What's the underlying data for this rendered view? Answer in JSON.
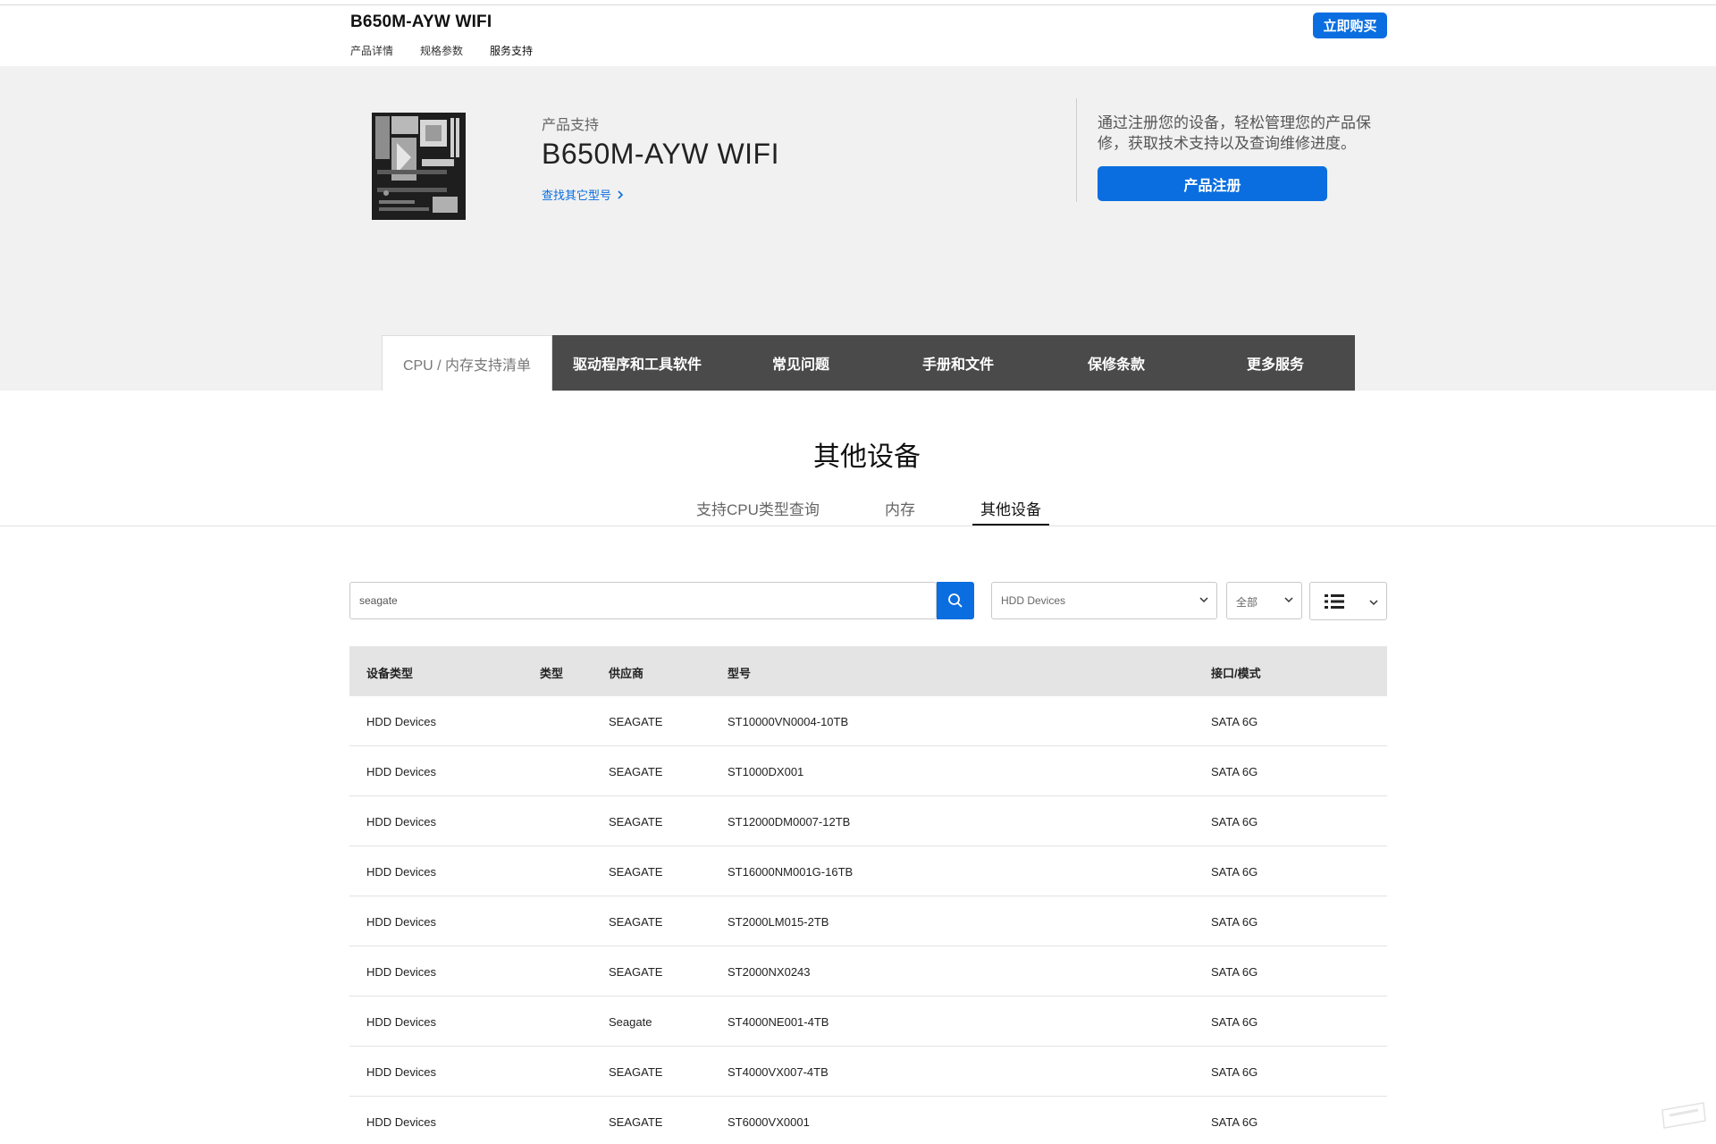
{
  "header": {
    "model": "B650M-AYW WIFI",
    "nav": [
      "产品详情",
      "规格参数",
      "服务支持"
    ],
    "buy_label": "立即购买"
  },
  "hero": {
    "eyebrow": "产品支持",
    "title": "B650M-AYW WIFI",
    "find_link": "查找其它型号",
    "register_text": "通过注册您的设备，轻松管理您的产品保修，获取技术支持以及查询维修进度。",
    "register_button": "产品注册"
  },
  "tabs": [
    "CPU / 内存支持清单",
    "驱动程序和工具软件",
    "常见问题",
    "手册和文件",
    "保修条款",
    "更多服务"
  ],
  "section": {
    "title": "其他设备",
    "subtabs": [
      "支持CPU类型查询",
      "内存",
      "其他设备"
    ],
    "active_subtab": "其他设备"
  },
  "filters": {
    "search_value": "seagate",
    "device_select": "HDD Devices",
    "range_select": "全部"
  },
  "table": {
    "columns": [
      "设备类型",
      "类型",
      "供应商",
      "型号",
      "接口/模式"
    ],
    "rows": [
      [
        "HDD Devices",
        "",
        "SEAGATE",
        "ST10000VN0004-10TB",
        "SATA 6G"
      ],
      [
        "HDD Devices",
        "",
        "SEAGATE",
        "ST1000DX001",
        "SATA 6G"
      ],
      [
        "HDD Devices",
        "",
        "SEAGATE",
        "ST12000DM0007-12TB",
        "SATA 6G"
      ],
      [
        "HDD Devices",
        "",
        "SEAGATE",
        "ST16000NM001G-16TB",
        "SATA 6G"
      ],
      [
        "HDD Devices",
        "",
        "SEAGATE",
        "ST2000LM015-2TB",
        "SATA 6G"
      ],
      [
        "HDD Devices",
        "",
        "SEAGATE",
        "ST2000NX0243",
        "SATA 6G"
      ],
      [
        "HDD Devices",
        "",
        "Seagate",
        "ST4000NE001-4TB",
        "SATA 6G"
      ],
      [
        "HDD Devices",
        "",
        "SEAGATE",
        "ST4000VX007-4TB",
        "SATA 6G"
      ],
      [
        "HDD Devices",
        "",
        "SEAGATE",
        "ST6000VX0001",
        "SATA 6G"
      ]
    ]
  },
  "colors": {
    "accent": "#0a6ee0",
    "tabbar": "#4a4a4a",
    "hero_bg": "#f1f1f1",
    "table_header_bg": "#e4e4e4"
  },
  "icons": [
    "motherboard-image",
    "chevron-right-icon",
    "search-icon",
    "chevron-down-icon",
    "list-view-icon",
    "watermark-logo"
  ]
}
